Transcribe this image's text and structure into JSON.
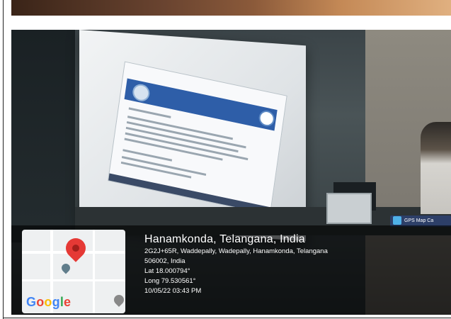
{
  "photo": {
    "description_label": "",
    "badge": {
      "text": "GPS Map Ca"
    }
  },
  "geotag": {
    "title": "Hanamkonda, Telangana, India",
    "address_line1": "2G2J+65R, Waddepally, Wadepally, Hanamkonda, Telangana",
    "address_line2": "506002, India",
    "latitude": "Lat 18.000794°",
    "longitude": "Long 79.530561°",
    "datetime": "10/05/22 03:43 PM"
  },
  "map": {
    "logo_letters": [
      "G",
      "o",
      "o",
      "g",
      "l",
      "e"
    ],
    "pin_icon": "map-pin-icon",
    "pin_color": "#e53935"
  },
  "colors": {
    "overlay": "#000000",
    "projector_header": "#2e5ea8"
  }
}
